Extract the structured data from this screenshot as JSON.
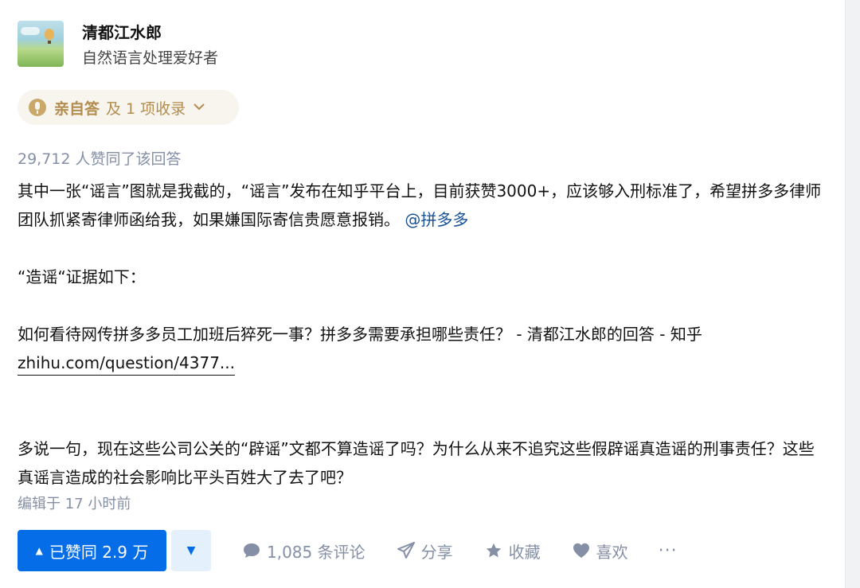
{
  "author": {
    "name": "清都江水郎",
    "headline": "自然语言处理爱好者"
  },
  "badge": {
    "primary": "亲自答",
    "secondary": "及 1 项收录"
  },
  "vote_summary": "29,712 人赞同了该回答",
  "content": {
    "para1_text": "其中一张“谣言”图就是我截的，“谣言”发布在知乎平台上，目前获赞3000+，应该够入刑标准了，希望拼多多律师团队抓紧寄律师函给我，如果嫌国际寄信贵愿意报销。",
    "para1_mention": "@拼多多",
    "para2": "“造谣“证据如下：",
    "link_title": "如何看待网传拼多多员工加班后猝死一事？拼多多需要承担哪些责任？ - 清都江水郎的回答 - 知乎",
    "link_url": "zhihu.com/question/4377...",
    "para3": "多说一句，现在这些公司公关的“辟谣”文都不算造谣了吗？为什么从来不追究这些假辟谣真造谣的刑事责任？这些真谣言造成的社会影响比平头百姓大了去了吧？"
  },
  "edited": "编辑于 17 小时前",
  "actions": {
    "upvote_label": "已赞同 2.9 万",
    "comment_label": "1,085 条评论",
    "share_label": "分享",
    "favorite_label": "收藏",
    "like_label": "喜欢",
    "more_label": "···"
  },
  "colors": {
    "primary_blue": "#056de8",
    "mention_blue": "#175199",
    "muted_gray": "#8590a6",
    "badge_gold": "#b38c4f"
  }
}
